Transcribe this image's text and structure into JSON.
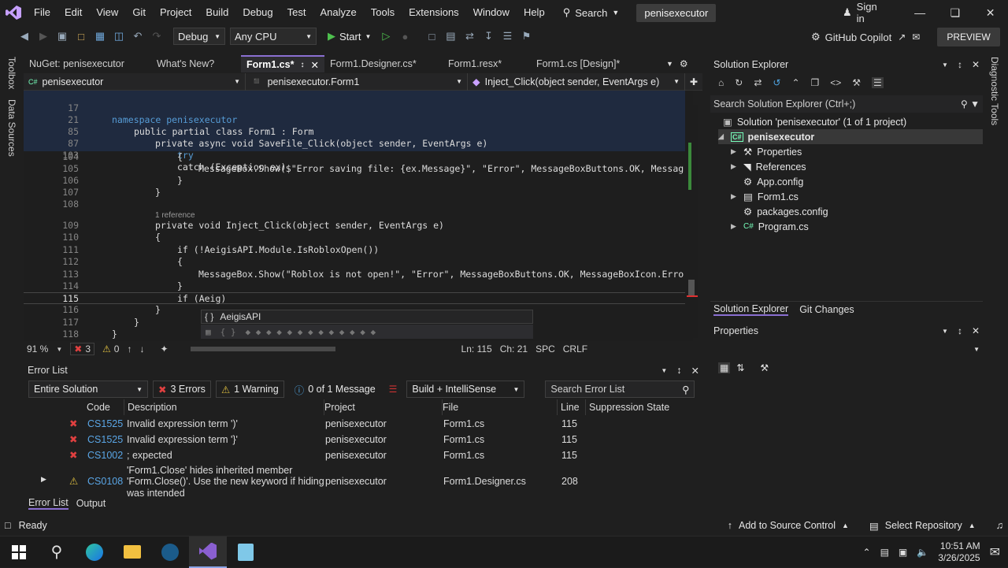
{
  "menubar": {
    "items": [
      "File",
      "Edit",
      "View",
      "Git",
      "Project",
      "Build",
      "Debug",
      "Test",
      "Analyze",
      "Tools",
      "Extensions",
      "Window",
      "Help"
    ],
    "search_label": "Search",
    "solution_name": "penisexecutor",
    "signin": "Sign in"
  },
  "toolbar": {
    "config": "Debug",
    "platform": "Any CPU",
    "start": "Start",
    "copilot": "GitHub Copilot",
    "preview": "PREVIEW"
  },
  "leftstrip": {
    "toolbox": "Toolbox",
    "datasources": "Data Sources"
  },
  "rightstrip": {
    "diag": "Diagnostic Tools"
  },
  "doctabs": [
    "NuGet: penisexecutor",
    "What's New?",
    "Form1.cs*",
    "Form1.Designer.cs*",
    "Form1.resx*",
    "Form1.cs [Design]*"
  ],
  "navbar": {
    "project": "penisexecutor",
    "class": "penisexecutor.Form1",
    "member": "Inject_Click(object sender, EventArgs e)"
  },
  "code": {
    "sticky": [
      {
        "ln": "17",
        "text": "namespace penisexecutor"
      },
      {
        "ln": "21",
        "text": "public partial class Form1 : Form"
      },
      {
        "ln": "85",
        "text": "private async void SaveFile_Click(object sender, EventArgs e)"
      },
      {
        "ln": "87",
        "text": "try"
      },
      {
        "ln": "103",
        "text": "catch (Exception ex)"
      }
    ],
    "lines": [
      {
        "ln": "104",
        "text": "{"
      },
      {
        "ln": "105",
        "text": "MessageBox.Show($\"Error saving file: {ex.Message}\", \"Error\", MessageBoxButtons.OK, Messag"
      },
      {
        "ln": "106",
        "text": "}"
      },
      {
        "ln": "107",
        "text": "}"
      },
      {
        "ln": "108",
        "text": ""
      },
      {
        "ln": "",
        "text": "1 reference"
      },
      {
        "ln": "109",
        "text": "private void Inject_Click(object sender, EventArgs e)"
      },
      {
        "ln": "110",
        "text": "{"
      },
      {
        "ln": "111",
        "text": "if (!AeigisAPI.Module.IsRobloxOpen())"
      },
      {
        "ln": "112",
        "text": "{"
      },
      {
        "ln": "113",
        "text": "MessageBox.Show(\"Roblox is not open!\", \"Error\", MessageBoxButtons.OK, MessageBoxIcon.Erro"
      },
      {
        "ln": "114",
        "text": "}"
      },
      {
        "ln": "115",
        "text": "if (Aeig)"
      },
      {
        "ln": "116",
        "text": "}"
      },
      {
        "ln": "117",
        "text": "}"
      },
      {
        "ln": "118",
        "text": "}"
      }
    ],
    "autocomplete": "AeigisAPI"
  },
  "edstatus": {
    "zoom": "91 %",
    "errors": "3",
    "warnings": "0",
    "ln": "Ln: 115",
    "ch": "Ch: 21",
    "spc": "SPC",
    "crlf": "CRLF"
  },
  "errorlist": {
    "title": "Error List",
    "scope": "Entire Solution",
    "errors_btn": "3 Errors",
    "warnings_btn": "1 Warning",
    "messages_btn": "0 of 1 Message",
    "build_filter": "Build + IntelliSense",
    "search_placeholder": "Search Error List",
    "columns": [
      "Code",
      "Description",
      "Project",
      "File",
      "Line",
      "Suppression State"
    ],
    "rows": [
      {
        "code": "CS1525",
        "desc": "Invalid expression term ')'",
        "project": "penisexecutor",
        "file": "Form1.cs",
        "line": "115",
        "kind": "error"
      },
      {
        "code": "CS1525",
        "desc": "Invalid expression term '}'",
        "project": "penisexecutor",
        "file": "Form1.cs",
        "line": "115",
        "kind": "error"
      },
      {
        "code": "CS1002",
        "desc": "; expected",
        "project": "penisexecutor",
        "file": "Form1.cs",
        "line": "115",
        "kind": "error"
      },
      {
        "code": "CS0108",
        "desc1": "'Form1.Close' hides inherited member",
        "desc2": "'Form.Close()'. Use the new keyword if hiding",
        "desc3": "was intended",
        "project": "penisexecutor",
        "file": "Form1.Designer.cs",
        "line": "208",
        "kind": "warning"
      }
    ],
    "tab_error": "Error List",
    "tab_output": "Output"
  },
  "solexp": {
    "title": "Solution Explorer",
    "search_placeholder": "Search Solution Explorer (Ctrl+;)",
    "solution": "Solution 'penisexecutor' (1 of 1 project)",
    "project": "penisexecutor",
    "items": [
      "Properties",
      "References",
      "App.config",
      "Form1.cs",
      "packages.config",
      "Program.cs"
    ],
    "tab1": "Solution Explorer",
    "tab2": "Git Changes"
  },
  "props": {
    "title": "Properties"
  },
  "status": {
    "ready": "Ready",
    "source": "Add to Source Control",
    "repo": "Select Repository"
  },
  "taskbar": {
    "time": "10:51 AM",
    "date": "3/26/2025"
  }
}
